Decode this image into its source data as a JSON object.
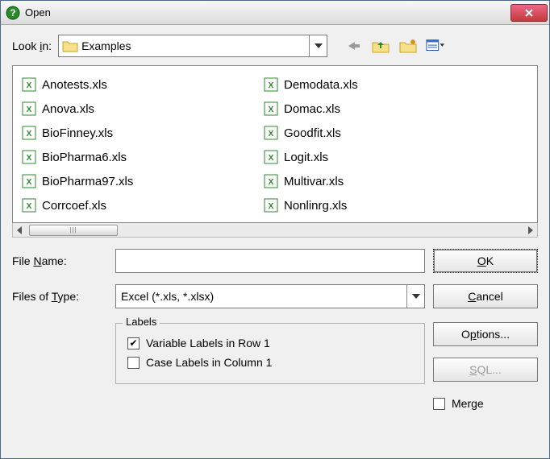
{
  "window": {
    "title": "Open"
  },
  "lookin": {
    "label": "Look in:",
    "folder": "Examples"
  },
  "files": {
    "col1": [
      "Anotests.xls",
      "Anova.xls",
      "BioFinney.xls",
      "BioPharma6.xls",
      "BioPharma97.xls",
      "Corrcoef.xls"
    ],
    "col2": [
      "Demodata.xls",
      "Domac.xls",
      "Goodfit.xls",
      "Logit.xls",
      "Multivar.xls",
      "Nonlinrg.xls"
    ]
  },
  "fields": {
    "filename_label": "File Name:",
    "filename_value": "",
    "filetype_label": "Files of Type:",
    "filetype_value": "Excel (*.xls, *.xlsx)"
  },
  "labels_group": {
    "legend": "Labels",
    "variable_labels": "Variable Labels in Row 1",
    "variable_labels_checked": true,
    "case_labels": "Case Labels in Column 1",
    "case_labels_checked": false
  },
  "buttons": {
    "ok": "OK",
    "cancel": "Cancel",
    "options": "Options...",
    "sql": "SQL..."
  },
  "merge": {
    "label": "Merge",
    "checked": false
  }
}
